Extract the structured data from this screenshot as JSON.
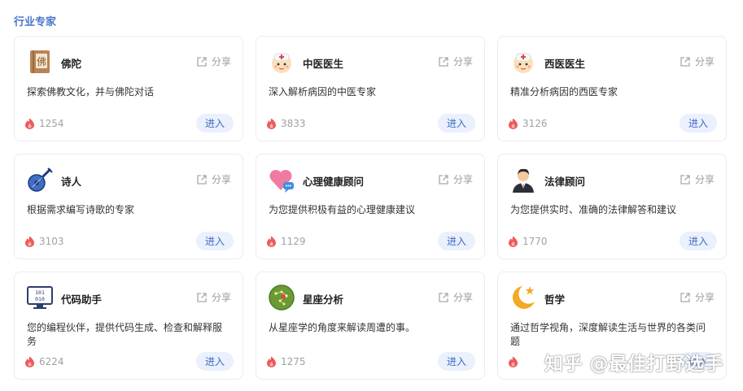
{
  "section": {
    "title": "行业专家"
  },
  "cards": [
    {
      "name": "佛陀",
      "icon": "buddha-book-icon",
      "desc": "探索佛教文化，并与佛陀对话",
      "heat": "1254",
      "share": "分享",
      "enter": "进入"
    },
    {
      "name": "中医医生",
      "icon": "doctor-icon",
      "desc": "深入解析病因的中医专家",
      "heat": "3833",
      "share": "分享",
      "enter": "进入"
    },
    {
      "name": "西医医生",
      "icon": "doctor-icon",
      "desc": "精准分析病因的西医专家",
      "heat": "3126",
      "share": "分享",
      "enter": "进入"
    },
    {
      "name": "诗人",
      "icon": "guitar-icon",
      "desc": "根据需求编写诗歌的专家",
      "heat": "3103",
      "share": "分享",
      "enter": "进入"
    },
    {
      "name": "心理健康顾问",
      "icon": "heart-chat-icon",
      "desc": "为您提供积极有益的心理健康建议",
      "heat": "1129",
      "share": "分享",
      "enter": "进入"
    },
    {
      "name": "法律顾问",
      "icon": "lawyer-icon",
      "desc": "为您提供实时、准确的法律解答和建议",
      "heat": "1770",
      "share": "分享",
      "enter": "进入"
    },
    {
      "name": "代码助手",
      "icon": "code-monitor-icon",
      "desc": "您的编程伙伴，提供代码生成、检查和解释服务",
      "heat": "6224",
      "share": "分享",
      "enter": "进入"
    },
    {
      "name": "星座分析",
      "icon": "constellation-icon",
      "desc": "从星座学的角度来解读周遭的事。",
      "heat": "1275",
      "share": "分享",
      "enter": "进入"
    },
    {
      "name": "哲学",
      "icon": "moon-star-icon",
      "desc": "通过哲学视角，深度解读生活与世界的各类问题",
      "heat": "",
      "share": "分享",
      "enter": "进入"
    }
  ],
  "watermark": "知乎 @最佳打野选手",
  "colors": {
    "accent": "#4a78c8",
    "button_bg": "#eaf0fc",
    "heat": "#ec5a5a"
  }
}
